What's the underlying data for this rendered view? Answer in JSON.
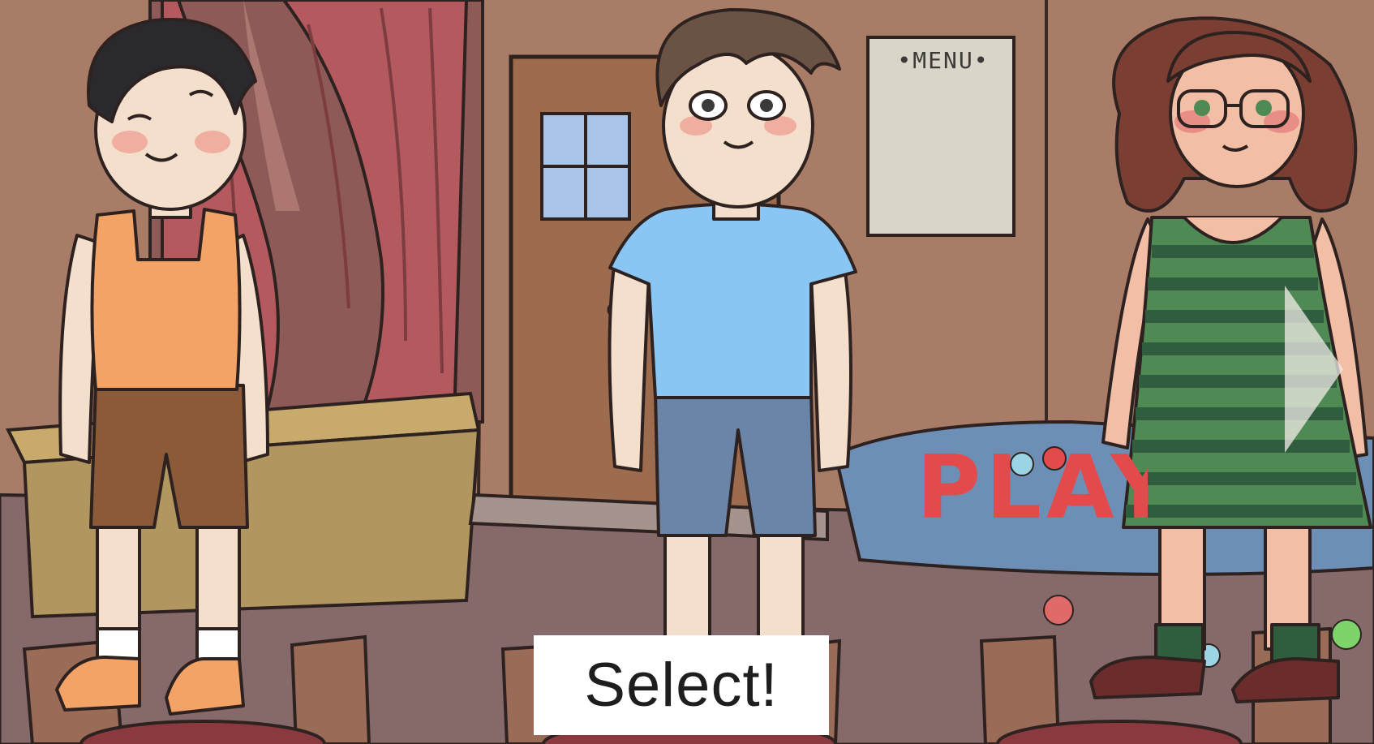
{
  "scene": {
    "menu_sign": "•MENU•",
    "play_sign": "PLAY",
    "select_button": "Select!",
    "next_arrow_icon": "chevron-right-icon",
    "characters": [
      {
        "id": "boy-tank-top",
        "outfit": "orange tank top, brown shorts"
      },
      {
        "id": "boy-blue-shirt",
        "outfit": "blue t-shirt, blue-gray shorts"
      },
      {
        "id": "girl-striped-dress",
        "outfit": "green striped dress, glasses"
      }
    ]
  },
  "colors": {
    "wall": "#a97c68",
    "floor": "#866a6a",
    "curtain": "#b45a5e",
    "door": "#9d6c4e",
    "select_bg": "#ffffff",
    "play_red": "#e34a4c"
  }
}
